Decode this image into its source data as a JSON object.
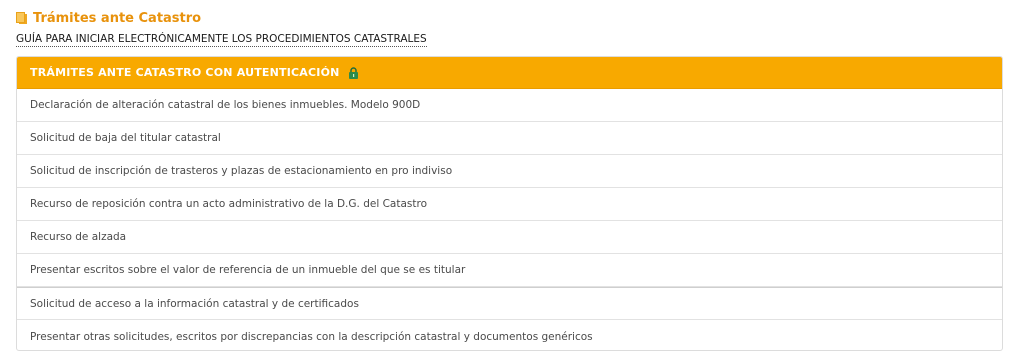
{
  "section": {
    "title": "Trámites ante Catastro",
    "icon": "document-icon"
  },
  "guide_link": "GUÍA PARA INICIAR ELECTRÓNICAMENTE LOS PROCEDIMIENTOS CATASTRALES",
  "panel": {
    "header": "TRÁMITES ANTE CATASTRO CON AUTENTICACIÓN",
    "header_icon": "lock-icon",
    "accent_color": "#f8a900",
    "items": [
      {
        "label": "Declaración de alteración catastral de los bienes inmuebles. Modelo 900D"
      },
      {
        "label": "Solicitud de baja del titular catastral"
      },
      {
        "label": "Solicitud de inscripción de trasteros y plazas de estacionamiento en pro indiviso"
      },
      {
        "label": "Recurso de reposición contra un acto administrativo de la D.G. del Catastro"
      },
      {
        "label": "Recurso de alzada"
      },
      {
        "label": "Presentar escritos sobre el valor de referencia de un inmueble del que se es titular"
      },
      {
        "label": "Solicitud de acceso a la información catastral y de certificados"
      },
      {
        "label": "Presentar otras solicitudes, escritos por discrepancias con la descripción catastral y documentos genéricos"
      }
    ]
  }
}
